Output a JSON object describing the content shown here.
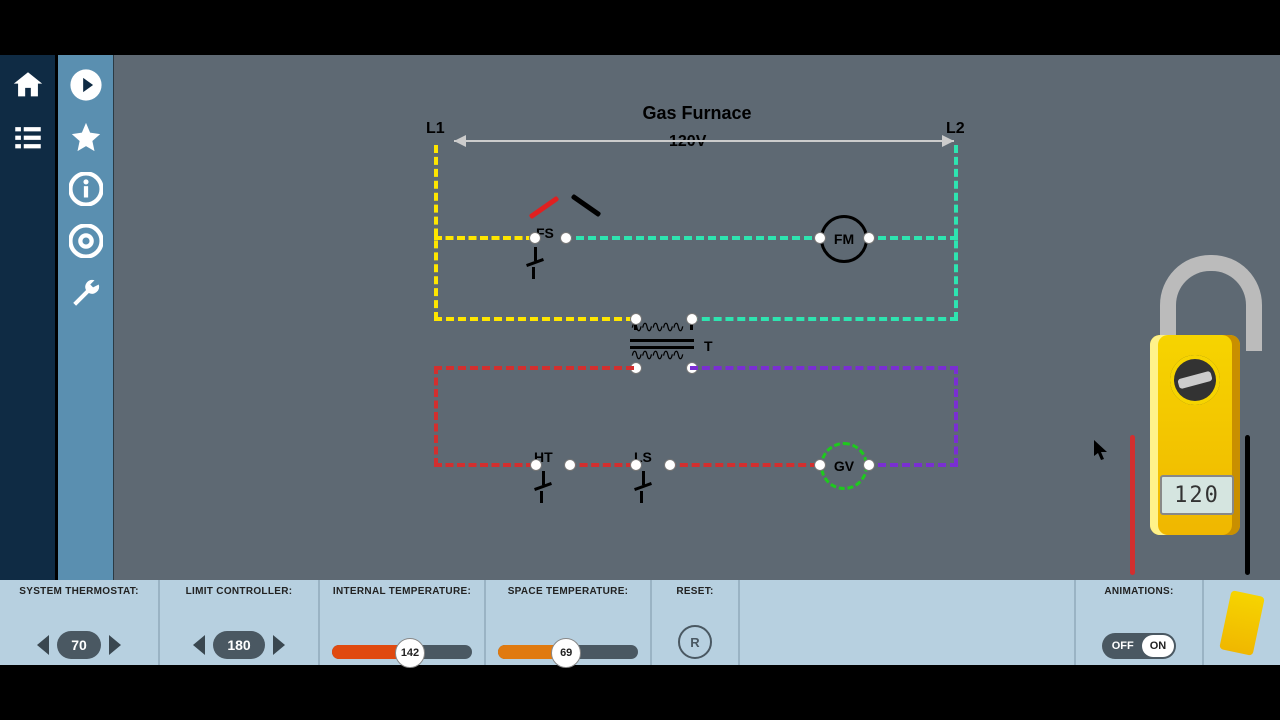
{
  "diagram": {
    "title": "Gas Furnace",
    "left_terminal": "L1",
    "right_terminal": "L2",
    "voltage": "120V",
    "components": {
      "fs": "FS",
      "fm": "FM",
      "t": "T",
      "ht": "HT",
      "ls": "LS",
      "gv": "GV"
    }
  },
  "meter": {
    "reading": "120"
  },
  "controls": {
    "thermostat": {
      "label": "SYSTEM THERMOSTAT:",
      "value": "70"
    },
    "limit": {
      "label": "LIMIT CONTROLLER:",
      "value": "180"
    },
    "internal_temp": {
      "label": "INTERNAL TEMPERATURE:",
      "value": "142",
      "fill_pct": 55,
      "fill_color": "#e04a10"
    },
    "space_temp": {
      "label": "SPACE TEMPERATURE:",
      "value": "69",
      "fill_pct": 48,
      "fill_color": "#e07a10"
    },
    "reset": {
      "label": "RESET:",
      "symbol": "R"
    },
    "animations": {
      "label": "ANIMATIONS:",
      "off": "OFF",
      "on": "ON"
    }
  }
}
